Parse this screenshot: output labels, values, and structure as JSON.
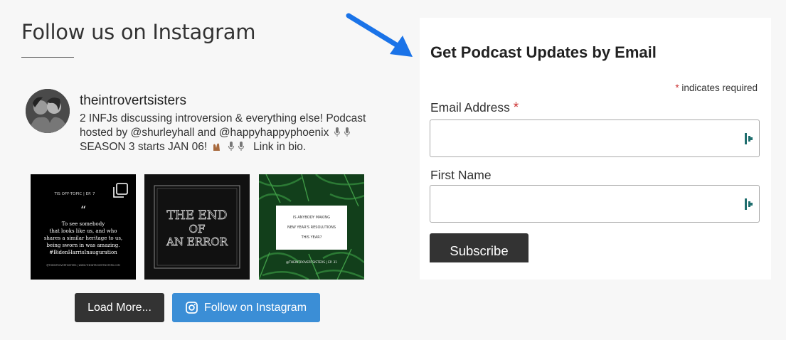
{
  "instagram": {
    "heading": "Follow us on Instagram",
    "username": "theintrovertsisters",
    "bio_line1": "2 INFJs discussing introversion & everything else! Podcast",
    "bio_line2": "hosted by @shurleyhall and @happyhappyphoenix",
    "bio_line3": "SEASON 3 starts JAN 06!",
    "bio_line3_end": "Link in bio.",
    "tiles": [
      {
        "header": "TIS OFF-TOPIC | EP. 7",
        "quote_mark": "“",
        "lines": [
          "To see somebody",
          "that looks like us, and who",
          "shares a similar heritage to us,",
          "being sworn in was amazing.",
          "#BidenHarrisInauguration"
        ],
        "footer": "@THEINTROVERTSISTERS | WWW.THEINTROVERTSISTERS.COM"
      },
      {
        "lines": [
          "THE END",
          "OF",
          "AN ERROR"
        ]
      },
      {
        "lines": [
          "IS ANYBODY MAKING",
          "NEW YEAR'S RESOLUTIONS",
          "THIS YEAR?"
        ],
        "footer": "@THEINTROVERTSISTERS | EP. 31"
      }
    ],
    "load_more_label": "Load More...",
    "follow_label": "Follow on Instagram"
  },
  "form": {
    "title": "Get Podcast Updates by Email",
    "required_asterisk": "*",
    "required_note": "indicates required",
    "email_label": "Email Address",
    "email_value": "",
    "first_name_label": "First Name",
    "first_name_value": "",
    "subscribe_label": "Subscribe"
  },
  "colors": {
    "accent_blue": "#3b8ed6",
    "arrow_blue": "#1a73e8",
    "dark_button": "#333333",
    "required_red": "#cc3333",
    "field_icon_teal": "#1f6e6e"
  },
  "icons": {
    "follow": "instagram-icon",
    "field": "password-manager-icon",
    "tile1_badge": "multiple-posts-icon",
    "bio_emoji": "microphone-icon"
  }
}
